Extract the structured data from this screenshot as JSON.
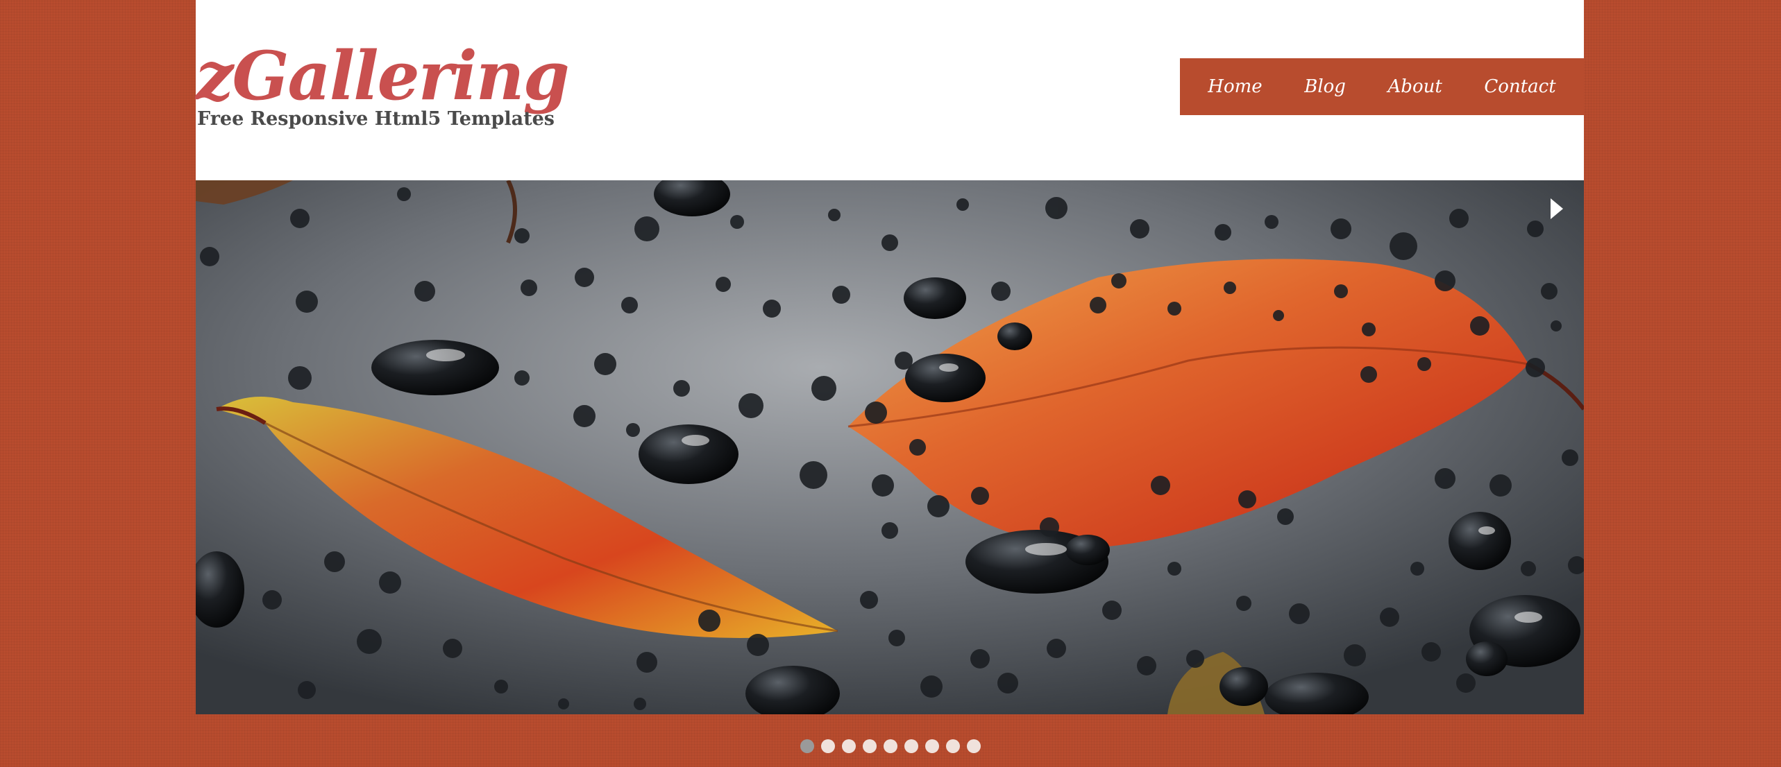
{
  "site": {
    "title": "zGallering",
    "tagline": "Free Responsive Html5 Templates"
  },
  "nav": {
    "items": [
      {
        "label": "Home"
      },
      {
        "label": "Blog"
      },
      {
        "label": "About"
      },
      {
        "label": "Contact"
      }
    ]
  },
  "slider": {
    "image": "autumn-leaves-water-drops",
    "next_icon": "triangle-right-icon",
    "dot_count": 9,
    "active_dot": 1
  },
  "colors": {
    "background": "#b84c2e",
    "nav_bg": "#b84c2e",
    "logo_red": "#c9504f",
    "tagline_gray": "#4a4a4a"
  }
}
